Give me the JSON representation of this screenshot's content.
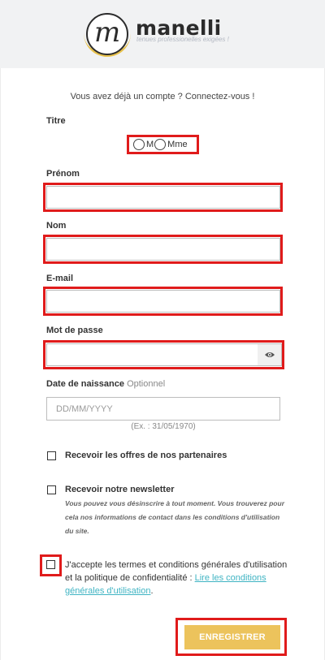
{
  "brand": {
    "initial": "m",
    "name": "manelli",
    "tagline": "tenues professionelles exigées !"
  },
  "login_prompt": "Vous avez déjà un compte ? Connectez-vous !",
  "form": {
    "title_label": "Titre",
    "title_options": [
      "M",
      "Mme"
    ],
    "firstname_label": "Prénom",
    "lastname_label": "Nom",
    "email_label": "E-mail",
    "password_label": "Mot de passe",
    "birthdate_label": "Date de naissance",
    "birthdate_optional": "Optionnel",
    "birthdate_placeholder": "DD/MM/YYYY",
    "birthdate_hint": "(Ex. : 31/05/1970)",
    "partners_label": "Recevoir les offres de nos partenaires",
    "newsletter_label": "Recevoir notre newsletter",
    "newsletter_note": "Vous pouvez vous désinscrire à tout moment. Vous trouverez pour cela nos informations de contact dans les conditions d'utilisation du site.",
    "terms_text": "J'accepte les termes et conditions générales d'utilisation et la politique de confidentialité :",
    "terms_link": "Lire les conditions générales d'utilisation",
    "terms_after": ".",
    "submit_label": "ENREGISTRER"
  },
  "colors": {
    "highlight": "#e01b1b",
    "submit_bg": "#ecc35c",
    "link": "#3fb4c3",
    "header_bg": "#f1f2f3"
  },
  "icons": {
    "password_toggle": "eye-icon"
  }
}
